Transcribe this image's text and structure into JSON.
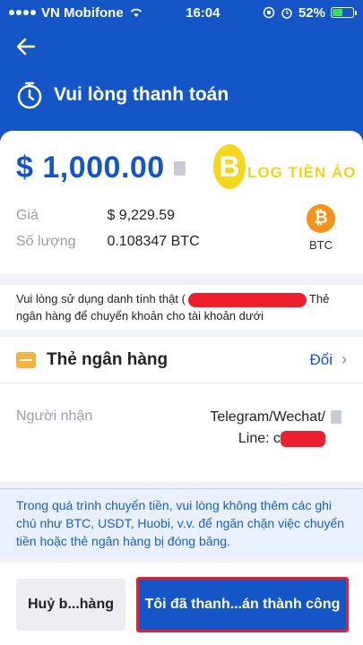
{
  "status": {
    "carrier": "VN Mobifone",
    "time": "16:04",
    "battery": "52%"
  },
  "header": {
    "title": "Vui lòng thanh toán"
  },
  "order": {
    "amount": "$ 1,000.00",
    "logo_letter": "B",
    "logo_text": "LOG TIỀN ẢO",
    "price_label": "Giá",
    "price_value": "$ 9,229.59",
    "qty_label": "Số lượng",
    "qty_value": "0.108347 BTC",
    "coin_symbol": "₿",
    "coin_label": "BTC"
  },
  "notice1": {
    "part1": "Vui lòng sử dụng danh tính thật (",
    "part2": "Thẻ ngân hàng để chuyển khoản cho tài khoản dưới"
  },
  "bank": {
    "title": "Thẻ ngân hàng",
    "change": "Đổi",
    "recipient_label": "Người nhận",
    "recipient_line1": "Telegram/Wechat/",
    "recipient_line2": "Line: c"
  },
  "notice2": {
    "text": "Trong quá trình chuyển tiền, vui lòng không thêm các ghi chú như BTC, USDT, Huobi, v.v. để ngăn chặn việc chuyển tiền hoặc thẻ ngân hàng bị đóng băng."
  },
  "actions": {
    "cancel": "Huỷ b...hàng",
    "confirm": "Tôi đã thanh...án thành công"
  },
  "colors": {
    "primary": "#1556c7",
    "bitcoin": "#f7931a",
    "redaction": "#ee1f2c"
  }
}
